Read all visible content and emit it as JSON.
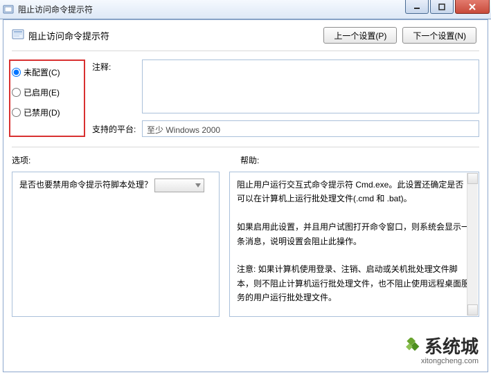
{
  "window": {
    "title": "阻止访问命令提示符"
  },
  "header": {
    "title": "阻止访问命令提示符",
    "prev_button": "上一个设置(P)",
    "next_button": "下一个设置(N)"
  },
  "radios": {
    "not_configured": "未配置(C)",
    "enabled": "已启用(E)",
    "disabled": "已禁用(D)",
    "selected": "not_configured"
  },
  "comment": {
    "label": "注释:",
    "value": ""
  },
  "platform": {
    "label": "支持的平台:",
    "value": "至少 Windows 2000"
  },
  "sections": {
    "options_label": "选项:",
    "help_label": "帮助:"
  },
  "options": {
    "question": "是否也要禁用命令提示符脚本处理？",
    "combo_value": ""
  },
  "help": {
    "p1": "阻止用户运行交互式命令提示符 Cmd.exe。此设置还确定是否可以在计算机上运行批处理文件(.cmd 和 .bat)。",
    "p2": "如果启用此设置，并且用户试图打开命令窗口，则系统会显示一条消息，说明设置会阻止此操作。",
    "p3": "注意: 如果计算机使用登录、注销、启动或关机批处理文件脚本，则不阻止计算机运行批处理文件，也不阻止使用远程桌面服务的用户运行批处理文件。"
  },
  "watermark": {
    "name": "系统城",
    "url": "xitongcheng.com"
  }
}
